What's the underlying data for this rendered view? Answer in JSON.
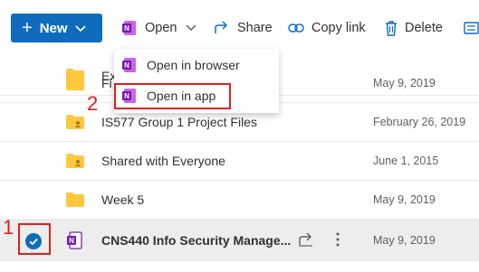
{
  "toolbar": {
    "new_label": "New",
    "open_label": "Open",
    "share_label": "Share",
    "copy_link_label": "Copy link",
    "delete_label": "Delete"
  },
  "open_menu": {
    "items": [
      {
        "label": "Open in browser"
      },
      {
        "label": "Open in app"
      }
    ]
  },
  "files": [
    {
      "name": "Ex",
      "date": "",
      "type": "folder"
    },
    {
      "name": "Fi",
      "date": "May 9, 2019",
      "type": "folder"
    },
    {
      "name": "IS577 Group 1 Project Files",
      "date": "February 26, 2019",
      "type": "shared-folder"
    },
    {
      "name": "Shared with Everyone",
      "date": "June 1, 2015",
      "type": "shared-folder"
    },
    {
      "name": "Week 5",
      "date": "May 9, 2019",
      "type": "folder"
    },
    {
      "name": "CNS440 Info Security Manage...",
      "date": "May 9, 2019",
      "type": "onenote",
      "selected": true
    }
  ],
  "annotations": {
    "step1": "1",
    "step2": "2"
  },
  "colors": {
    "accent": "#0f6cbd",
    "onenote": "#7719aa",
    "folder": "#ffc83d",
    "annotation": "#e0201a"
  }
}
